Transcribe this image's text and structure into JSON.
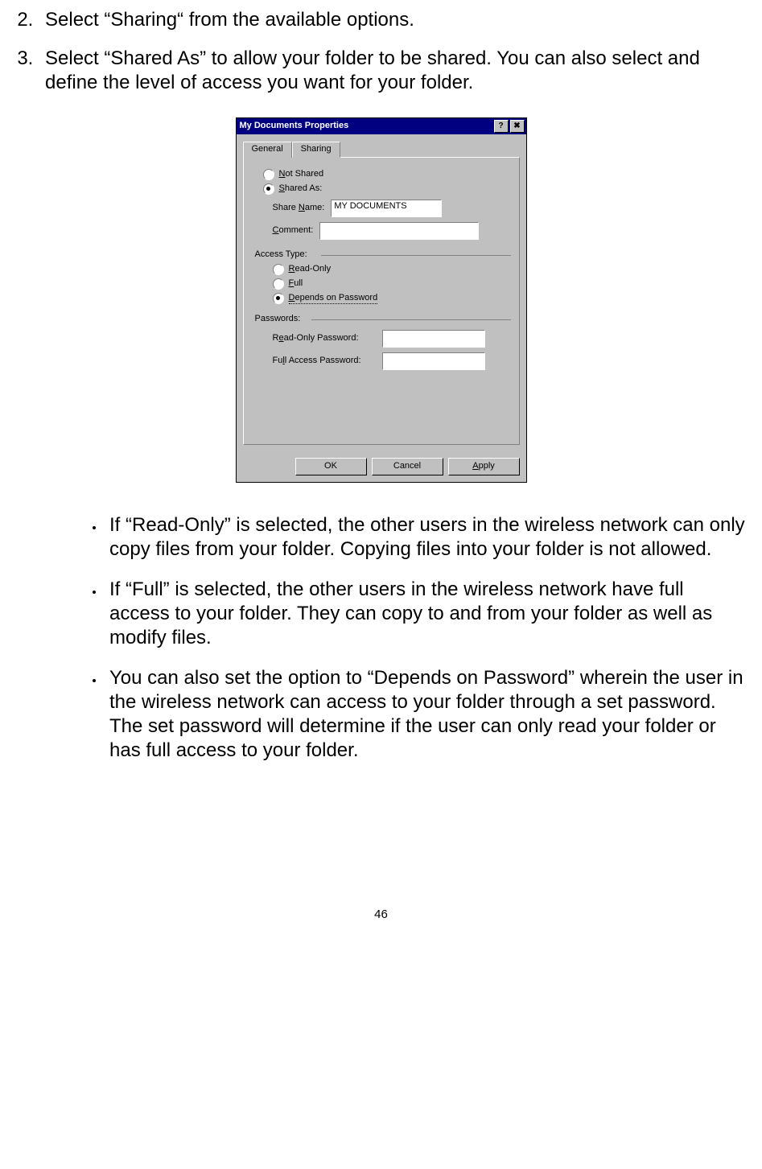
{
  "steps": {
    "s2": "Select “Sharing“ from the available options.",
    "s3": "Select “Shared As” to allow your folder to be shared.  You can also select and define the level of access you want for your folder."
  },
  "dialog": {
    "title": "My Documents Properties",
    "help_glyph": "?",
    "close_glyph": "✖",
    "tabs": {
      "general": "General",
      "sharing": "Sharing"
    },
    "not_shared": "Not Shared",
    "shared_as": "Shared As:",
    "share_name_label": "Share Name:",
    "share_name_value": "MY DOCUMENTS",
    "comment_label": "Comment:",
    "comment_value": "",
    "access_type_label": "Access Type:",
    "read_only": "Read-Only",
    "full": "Full",
    "depends": "Depends on Password",
    "passwords_label": "Passwords:",
    "ro_pw_label": "Read-Only Password:",
    "ro_pw_value": "",
    "full_pw_label": "Full Access Password:",
    "full_pw_value": "",
    "ok": "OK",
    "cancel": "Cancel",
    "apply": "Apply"
  },
  "bullets": {
    "b1": "If “Read-Only” is selected, the other users in the wireless network can only copy files from your folder.  Copying files into your folder is not allowed.",
    "b2": "If “Full” is selected, the other users in the wireless network have full access to your folder.  They can copy to and from your folder as well as modify files.",
    "b3": "You can also set the option to “Depends on Password” wherein the user in the wireless network can access to your folder through a set password.  The set password will determine if the user can only read your folder or has full access to your folder."
  },
  "page_number": "46"
}
